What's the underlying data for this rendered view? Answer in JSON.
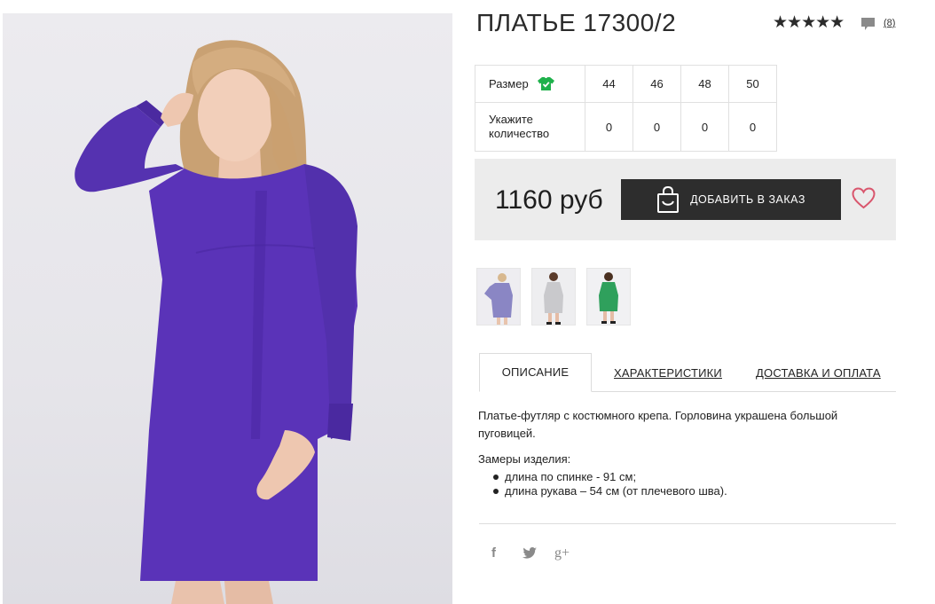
{
  "product": {
    "title": "ПЛАТЬЕ 17300/2",
    "rating_stars": "★★★★★",
    "review_count": "(8)",
    "price": "1160 руб",
    "order_button_label": "ДОБАВИТЬ В ЗАКАЗ"
  },
  "size_table": {
    "size_label": "Размер",
    "qty_label_line1": "Укажите",
    "qty_label_line2": "количество",
    "sizes": [
      "44",
      "46",
      "48",
      "50"
    ],
    "quantities": [
      "0",
      "0",
      "0",
      "0"
    ]
  },
  "thumbnails": [
    {
      "color_name": "purple",
      "dress_color": "#8a86c4"
    },
    {
      "color_name": "grey",
      "dress_color": "#c9c9cc"
    },
    {
      "color_name": "green",
      "dress_color": "#2fa05c"
    }
  ],
  "tabs": {
    "description": "ОПИСАНИЕ",
    "specs": "ХАРАКТЕРИСТИКИ",
    "delivery": "ДОСТАВКА И ОПЛАТА"
  },
  "description": {
    "text": "Платье-футляр с костюмного крепа. Горловина украшена большой пуговицей.",
    "measures_title": "Замеры изделия:",
    "measures": [
      "длина по спинке - 91 см;",
      "длина рукава – 54 см (от плечевого шва)."
    ]
  },
  "social": {
    "facebook": "f",
    "twitter": "twitter-icon",
    "gplus": "g+"
  },
  "colors": {
    "accent_green": "#1fb14c",
    "dark_button": "#2d2d2d",
    "heart": "#d9566d",
    "dress_main": "#5a33b8"
  }
}
